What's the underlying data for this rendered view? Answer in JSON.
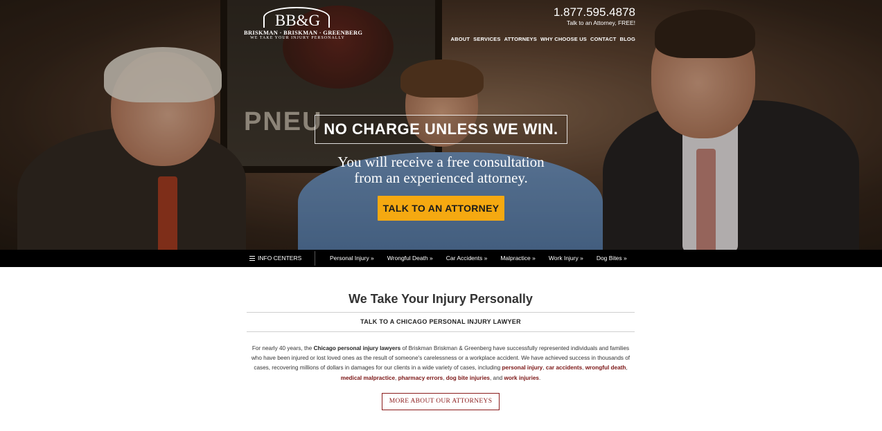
{
  "logo": {
    "mark": "BB&G",
    "name": "BRISKMAN · BRISKMAN · GREENBERG",
    "tagline": "WE TAKE YOUR INJURY PERSONALLY"
  },
  "header": {
    "phone": "1.877.595.4878",
    "phone_sub": "Talk to an Attorney, FREE!",
    "nav": [
      "ABOUT",
      "SERVICES",
      "ATTORNEYS",
      "WHY CHOOSE US",
      "CONTACT",
      "BLOG"
    ]
  },
  "hero": {
    "background_text": "PNEU",
    "headline": "NO CHARGE UNLESS WE WIN.",
    "sub_line1": "You will receive a free consultation",
    "sub_line2": "from an experienced attorney.",
    "cta": "TALK TO AN ATTORNEY",
    "cta_color": "#f5a911"
  },
  "infobar": {
    "menu_label": "INFO CENTERS",
    "links": [
      "Personal Injury »",
      "Wrongful Death »",
      "Car Accidents »",
      "Malpractice »",
      "Work Injury »",
      "Dog Bites »"
    ]
  },
  "content": {
    "title": "We Take Your Injury Personally",
    "subhead": "TALK TO A CHICAGO PERSONAL INJURY LAWYER",
    "para_1": "For nearly 40 years, the ",
    "para_bold": "Chicago personal injury lawyers",
    "para_2": " of Briskman Briskman & Greenberg have successfully represented individuals and families who have been injured or lost loved ones as the result of someone's carelessness or a workplace accident. We have achieved success in thousands of cases, recovering millions of dollars in damages for our clients in a wide variety of cases, including ",
    "link_personal_injury": "personal injury",
    "link_car_accidents": "car accidents",
    "link_wrongful_death": "wrongful death",
    "link_medical_malpractice": "medical malpractice",
    "link_pharmacy_errors": "pharmacy errors",
    "link_dog_bite": "dog bite injuries",
    "link_work_injuries": "work injuries",
    "sep_comma": ", ",
    "sep_and": ", and ",
    "period": ".",
    "button": "MORE ABOUT OUR ATTORNEYS",
    "accent_color": "#8b1b1b"
  }
}
